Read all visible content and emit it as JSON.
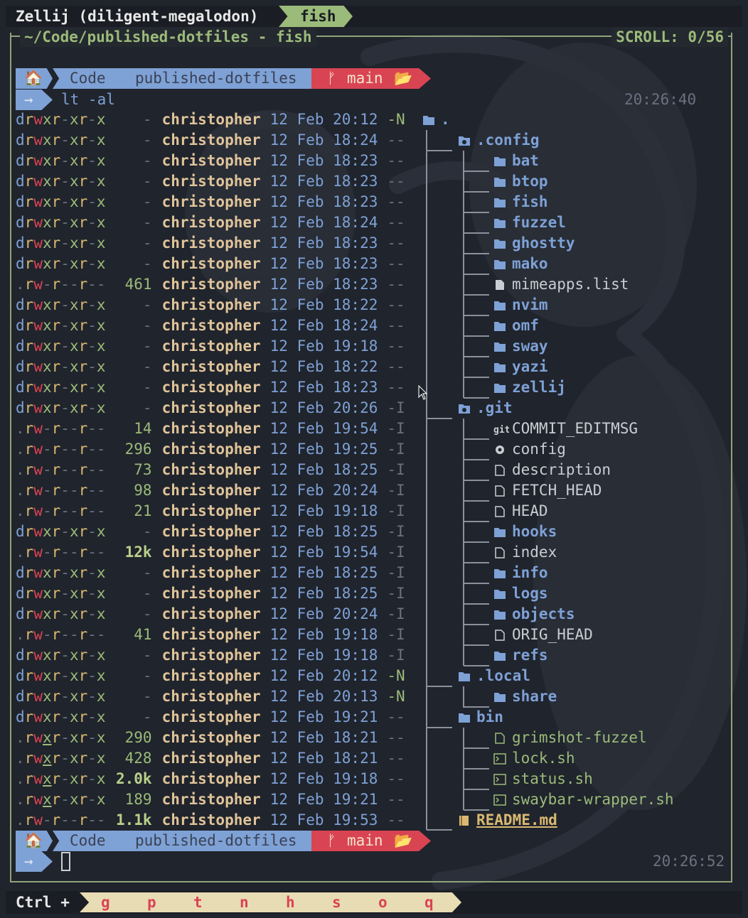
{
  "tabbar": {
    "session": "Zellij (diligent-megalodon)",
    "active_tab": "fish"
  },
  "pane": {
    "title": "~/Code/published-dotfiles - fish",
    "scroll": "SCROLL:  0/56"
  },
  "prompt": {
    "path": [
      "Code",
      "published-dotfiles"
    ],
    "branch": "main",
    "arrow": "→",
    "command": "lt -al",
    "time1": "20:26:40",
    "time2": "20:26:52"
  },
  "listing": [
    {
      "perm": "drwxr-xr-x",
      "size": "-",
      "user": "christopher",
      "date": "12 Feb 20:12",
      "git": "-N",
      "name": "."
    },
    {
      "perm": "drwxr-xr-x",
      "size": "-",
      "user": "christopher",
      "date": "12 Feb 18:24",
      "git": "--",
      "name": ".config"
    },
    {
      "perm": "drwxr-xr-x",
      "size": "-",
      "user": "christopher",
      "date": "12 Feb 18:23",
      "git": "--",
      "name": "bat"
    },
    {
      "perm": "drwxr-xr-x",
      "size": "-",
      "user": "christopher",
      "date": "12 Feb 18:23",
      "git": "--",
      "name": "btop"
    },
    {
      "perm": "drwxr-xr-x",
      "size": "-",
      "user": "christopher",
      "date": "12 Feb 18:23",
      "git": "--",
      "name": "fish"
    },
    {
      "perm": "drwxr-xr-x",
      "size": "-",
      "user": "christopher",
      "date": "12 Feb 18:24",
      "git": "--",
      "name": "fuzzel"
    },
    {
      "perm": "drwxr-xr-x",
      "size": "-",
      "user": "christopher",
      "date": "12 Feb 18:23",
      "git": "--",
      "name": "ghostty"
    },
    {
      "perm": "drwxr-xr-x",
      "size": "-",
      "user": "christopher",
      "date": "12 Feb 18:23",
      "git": "--",
      "name": "mako"
    },
    {
      "perm": ".rw-r--r--",
      "size": "461",
      "user": "christopher",
      "date": "12 Feb 18:23",
      "git": "--",
      "name": "mimeapps.list"
    },
    {
      "perm": "drwxr-xr-x",
      "size": "-",
      "user": "christopher",
      "date": "12 Feb 18:22",
      "git": "--",
      "name": "nvim"
    },
    {
      "perm": "drwxr-xr-x",
      "size": "-",
      "user": "christopher",
      "date": "12 Feb 18:24",
      "git": "--",
      "name": "omf"
    },
    {
      "perm": "drwxr-xr-x",
      "size": "-",
      "user": "christopher",
      "date": "12 Feb 19:18",
      "git": "--",
      "name": "sway"
    },
    {
      "perm": "drwxr-xr-x",
      "size": "-",
      "user": "christopher",
      "date": "12 Feb 18:22",
      "git": "--",
      "name": "yazi"
    },
    {
      "perm": "drwxr-xr-x",
      "size": "-",
      "user": "christopher",
      "date": "12 Feb 18:23",
      "git": "--",
      "name": "zellij"
    },
    {
      "perm": "drwxr-xr-x",
      "size": "-",
      "user": "christopher",
      "date": "12 Feb 20:26",
      "git": "-I",
      "name": ".git"
    },
    {
      "perm": ".rw-r--r--",
      "size": "14",
      "user": "christopher",
      "date": "12 Feb 19:54",
      "git": "-I",
      "name": "COMMIT_EDITMSG"
    },
    {
      "perm": ".rw-r--r--",
      "size": "296",
      "user": "christopher",
      "date": "12 Feb 19:25",
      "git": "-I",
      "name": "config"
    },
    {
      "perm": ".rw-r--r--",
      "size": "73",
      "user": "christopher",
      "date": "12 Feb 18:25",
      "git": "-I",
      "name": "description"
    },
    {
      "perm": ".rw-r--r--",
      "size": "98",
      "user": "christopher",
      "date": "12 Feb 20:24",
      "git": "-I",
      "name": "FETCH_HEAD"
    },
    {
      "perm": ".rw-r--r--",
      "size": "21",
      "user": "christopher",
      "date": "12 Feb 19:18",
      "git": "-I",
      "name": "HEAD"
    },
    {
      "perm": "drwxr-xr-x",
      "size": "-",
      "user": "christopher",
      "date": "12 Feb 18:25",
      "git": "-I",
      "name": "hooks"
    },
    {
      "perm": ".rw-r--r--",
      "size": "12k",
      "user": "christopher",
      "date": "12 Feb 19:54",
      "git": "-I",
      "name": "index"
    },
    {
      "perm": "drwxr-xr-x",
      "size": "-",
      "user": "christopher",
      "date": "12 Feb 18:25",
      "git": "-I",
      "name": "info"
    },
    {
      "perm": "drwxr-xr-x",
      "size": "-",
      "user": "christopher",
      "date": "12 Feb 18:25",
      "git": "-I",
      "name": "logs"
    },
    {
      "perm": "drwxr-xr-x",
      "size": "-",
      "user": "christopher",
      "date": "12 Feb 20:24",
      "git": "-I",
      "name": "objects"
    },
    {
      "perm": ".rw-r--r--",
      "size": "41",
      "user": "christopher",
      "date": "12 Feb 19:18",
      "git": "-I",
      "name": "ORIG_HEAD"
    },
    {
      "perm": "drwxr-xr-x",
      "size": "-",
      "user": "christopher",
      "date": "12 Feb 19:18",
      "git": "-I",
      "name": "refs"
    },
    {
      "perm": "drwxr-xr-x",
      "size": "-",
      "user": "christopher",
      "date": "12 Feb 20:12",
      "git": "-N",
      "name": ".local"
    },
    {
      "perm": "drwxr-xr-x",
      "size": "-",
      "user": "christopher",
      "date": "12 Feb 20:13",
      "git": "-N",
      "name": "share"
    },
    {
      "perm": "drwxr-xr-x",
      "size": "-",
      "user": "christopher",
      "date": "12 Feb 19:21",
      "git": "--",
      "name": "bin"
    },
    {
      "perm": ".rwxr-xr-x",
      "size": "290",
      "user": "christopher",
      "date": "12 Feb 18:21",
      "git": "--",
      "name": "grimshot-fuzzel"
    },
    {
      "perm": ".rwxr-xr-x",
      "size": "428",
      "user": "christopher",
      "date": "12 Feb 18:21",
      "git": "--",
      "name": "lock.sh"
    },
    {
      "perm": ".rwxr-xr-x",
      "size": "2.0k",
      "user": "christopher",
      "date": "12 Feb 19:18",
      "git": "--",
      "name": "status.sh"
    },
    {
      "perm": ".rwxr-xr-x",
      "size": "189",
      "user": "christopher",
      "date": "12 Feb 19:21",
      "git": "--",
      "name": "swaybar-wrapper.sh"
    },
    {
      "perm": ".rw-r--r--",
      "size": "1.1k",
      "user": "christopher",
      "date": "12 Feb 19:53",
      "git": "--",
      "name": "README.md"
    }
  ],
  "statusbar": {
    "ctrl": "Ctrl +",
    "keys": [
      "g",
      "p",
      "t",
      "n",
      "h",
      "s",
      "o",
      "q"
    ]
  },
  "colors": {
    "accent_green": "#9bbb7a",
    "accent_blue": "#7ea1d6",
    "accent_red": "#d94453",
    "background": "#20242c"
  }
}
